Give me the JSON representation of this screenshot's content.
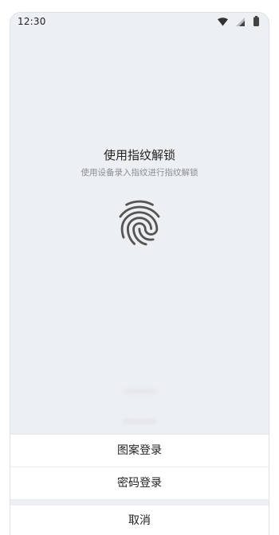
{
  "status_bar": {
    "time": "12:30",
    "icons": [
      "wifi-icon",
      "signal-icon",
      "battery-icon"
    ]
  },
  "unlock": {
    "title": "使用指纹解锁",
    "subtitle": "使用设备录入指纹进行指纹解锁",
    "icon": "fingerprint-icon"
  },
  "sheet": {
    "options": [
      {
        "label": "图案登录"
      },
      {
        "label": "密码登录"
      }
    ],
    "cancel_label": "取消"
  },
  "colors": {
    "background": "#edf0f3",
    "sheet": "#ffffff",
    "text": "#222222",
    "subtext": "#8a8d91",
    "icon": "#555555"
  }
}
